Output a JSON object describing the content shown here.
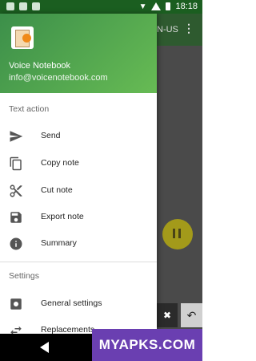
{
  "status_bar": {
    "time": "18:18"
  },
  "background": {
    "toolbar_text": "N-US",
    "menu_glyph": "⋮",
    "clear_glyph": "✖",
    "undo_glyph": "↶"
  },
  "drawer": {
    "app_name": "Voice Notebook",
    "email": "info@voicenotebook.com",
    "sections": [
      {
        "title": "Text action",
        "items": [
          {
            "label": "Send",
            "icon": "send-icon"
          },
          {
            "label": "Copy note",
            "icon": "copy-icon"
          },
          {
            "label": "Cut note",
            "icon": "scissors-icon"
          },
          {
            "label": "Export note",
            "icon": "save-icon"
          },
          {
            "label": "Summary",
            "icon": "info-icon"
          }
        ]
      },
      {
        "title": "Settings",
        "items": [
          {
            "label": "General settings",
            "icon": "settings-icon"
          },
          {
            "label": "Replacements",
            "icon": "swap-icon"
          }
        ]
      }
    ]
  },
  "watermark": "MYAPKS.COM"
}
